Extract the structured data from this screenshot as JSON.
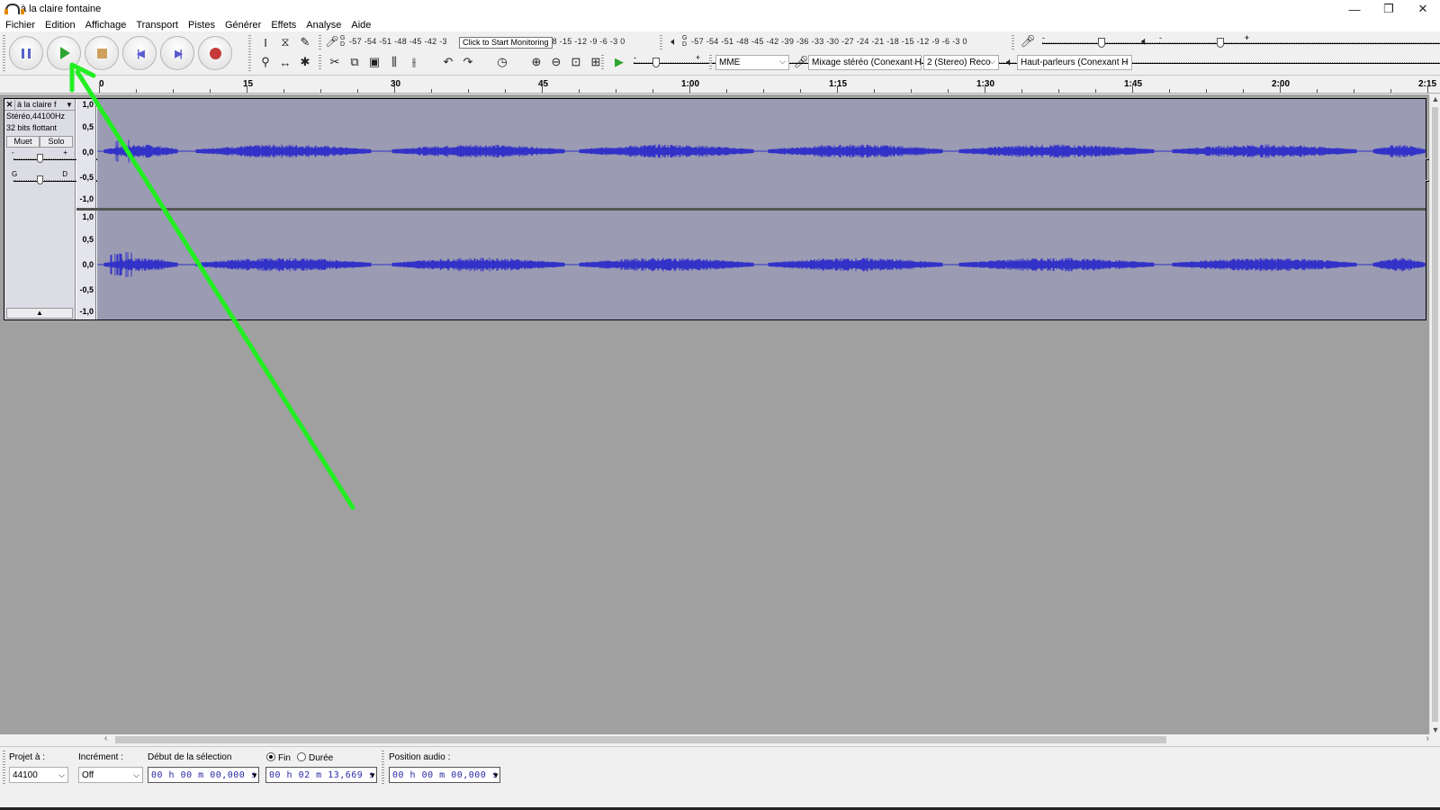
{
  "window": {
    "title": "à la claire fontaine",
    "minimize": "—",
    "restore": "❐",
    "close": "✕"
  },
  "menu": [
    "Fichier",
    "Edition",
    "Affichage",
    "Transport",
    "Pistes",
    "Générer",
    "Effets",
    "Analyse",
    "Aide"
  ],
  "record_meter": {
    "scale": "-57 -54 -51 -48 -45 -42 -3",
    "tooltip": "Click to Start Monitoring",
    "scale_tail": "1 -18 -15 -12  -9  -6  -3  0",
    "channels": "G D"
  },
  "playback_meter": {
    "scale": "-57 -54 -51 -48 -45 -42 -39 -36 -33 -30 -27 -24 -21 -18 -15 -12  -9  -6  -3  0",
    "channels": "G D"
  },
  "device": {
    "host": "MME",
    "input": "Mixage stéréo (Conexant H",
    "channels": "2 (Stereo) Reco",
    "output": "Haut-parleurs (Conexant H"
  },
  "ruler": {
    "labels": [
      "0",
      "15",
      "30",
      "45",
      "1:00",
      "1:15",
      "1:30",
      "1:45",
      "2:00"
    ],
    "end": "2:15"
  },
  "track": {
    "name": "à la claire f",
    "close": "✕",
    "menu": "▼",
    "format": "Stéréo,44100Hz",
    "bits": "32 bits flottant",
    "mute": "Muet",
    "solo": "Solo",
    "gain_minus": "-",
    "gain_plus": "+",
    "pan_left": "G",
    "pan_right": "D",
    "collapse": "▲",
    "vruler_labels": [
      "1,0",
      "0,5",
      "0,0",
      "-0,5",
      "-1,0"
    ]
  },
  "selection_bar": {
    "project_rate_label": "Projet à :",
    "project_rate": "44100",
    "snap_label": "Incrément :",
    "snap": "Off",
    "sel_start_label": "Début de la sélection",
    "end_label": "Fin",
    "length_label": "Durée",
    "sel_start": "00 h 00 m 00,000 s",
    "sel_end": "00 h 02 m 13,669 s",
    "audio_pos_label": "Position audio :",
    "audio_pos": "00 h 00 m 00,000 s"
  },
  "colors": {
    "waveform": "#3232c8",
    "wave_bg": "#9b9bb3",
    "annotation_arrow": "#22ee22"
  }
}
